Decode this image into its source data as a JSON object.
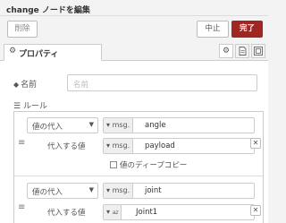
{
  "window": {
    "title": "change ノードを編集"
  },
  "toolbar": {
    "delete_label": "削除",
    "cancel_label": "中止",
    "done_label": "完了"
  },
  "tabs": {
    "properties_label": "プロパティ"
  },
  "name_field": {
    "label": "名前",
    "placeholder": "名前",
    "value": ""
  },
  "rules": {
    "label": "ルール",
    "items": [
      {
        "action": "値の代入",
        "target_type": "msg.",
        "target_value": "angle",
        "to_label": "代入する値",
        "value_type": "msg.",
        "value": "payload",
        "deep_copy_label": "値のディープコピー",
        "deep_copy_checked": false
      },
      {
        "action": "値の代入",
        "target_type": "msg.",
        "target_value": "joint",
        "to_label": "代入する値",
        "value_type": "az",
        "value": "Joint1"
      }
    ]
  },
  "colors": {
    "primary": "#a12622",
    "border": "#cccccc",
    "background": "#f3f3f3"
  },
  "icons": {
    "tab_settings": "gear-icon",
    "tab_description": "file-icon",
    "tab_appearance": "layout-icon",
    "name": "tag-icon",
    "rules": "list-icon",
    "drag": "drag-handle-icon",
    "remove": "close-icon"
  }
}
